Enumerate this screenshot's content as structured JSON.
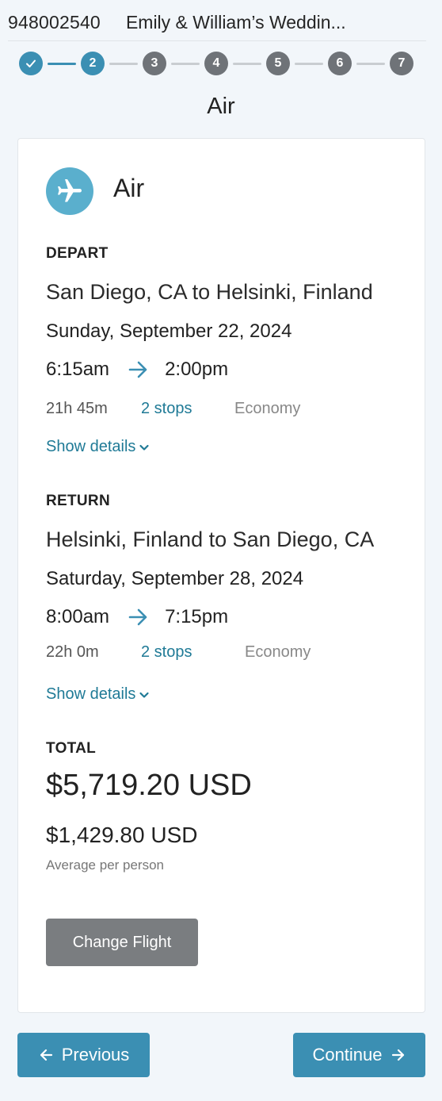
{
  "header": {
    "booking_number": "948002540",
    "event_title": "Emily & William’s Weddin..."
  },
  "stepper": {
    "steps": [
      {
        "label": "",
        "state": "done",
        "icon": "check-icon"
      },
      {
        "label": "2",
        "state": "current"
      },
      {
        "label": "3",
        "state": "todo"
      },
      {
        "label": "4",
        "state": "todo"
      },
      {
        "label": "5",
        "state": "todo"
      },
      {
        "label": "6",
        "state": "todo"
      },
      {
        "label": "7",
        "state": "todo"
      }
    ]
  },
  "page_title": "Air",
  "card": {
    "title": "Air",
    "icon": "airplane-icon",
    "depart": {
      "label": "DEPART",
      "route": "San Diego, CA to Helsinki, Finland",
      "date": "Sunday, September 22, 2024",
      "departure_time": "6:15am",
      "arrival_time": "2:00pm",
      "duration": "21h 45m",
      "stops": "2 stops",
      "cabin": "Economy",
      "details_link": "Show details"
    },
    "return": {
      "label": "RETURN",
      "route": "Helsinki, Finland to San Diego, CA",
      "date": "Saturday, September 28, 2024",
      "departure_time": "8:00am",
      "arrival_time": "7:15pm",
      "duration": "22h 0m",
      "stops": "2 stops",
      "cabin": "Economy",
      "details_link": "Show details"
    },
    "total": {
      "label": "TOTAL",
      "amount": "$5,719.20 USD",
      "per_person_amount": "$1,429.80 USD",
      "per_person_label": "Average per person"
    },
    "change_button": "Change Flight"
  },
  "navigation": {
    "previous_label": "Previous",
    "continue_label": "Continue"
  },
  "colors": {
    "accent": "#3b8fb3",
    "link": "#1f7a96",
    "inactive_step": "#6f7378",
    "secondary_button": "#7a7d80",
    "background": "#f2f6fa"
  }
}
